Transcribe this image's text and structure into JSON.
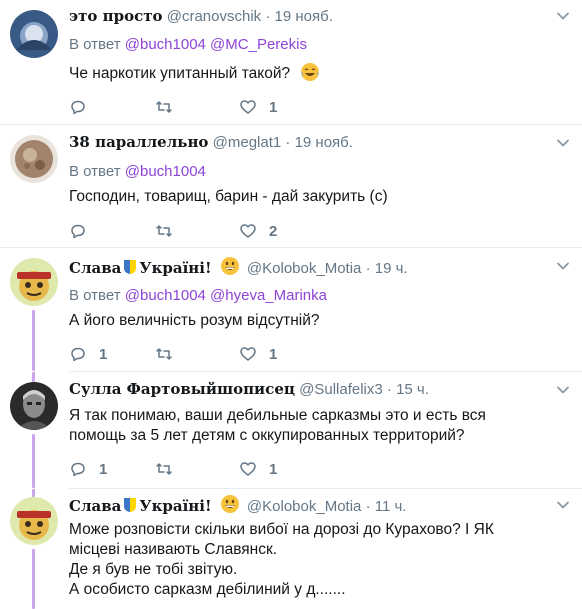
{
  "reply_prefix": "В ответ",
  "tweets": [
    {
      "name": "это просто",
      "handle": "@cranovschik",
      "dot": "·",
      "time": "19 нояб.",
      "mentions": [
        "@buch1004",
        "@MC_Perekis"
      ],
      "lines": [
        "Че наркотик упитанный такой?"
      ],
      "trailing_emoji": "face-with-tears-of-joy",
      "counts": {
        "reply": "",
        "retweet": "",
        "like": "1"
      }
    },
    {
      "name": "38 параллельно",
      "handle": "@meglat1",
      "dot": "·",
      "time": "19 нояб.",
      "mentions": [
        "@buch1004"
      ],
      "lines": [
        "Господин, товарищ, барин - дай закурить (с)"
      ],
      "counts": {
        "reply": "",
        "retweet": "",
        "like": "2"
      }
    },
    {
      "name_part1": "Слава",
      "name_part2": "Україні!",
      "handle": "@Kolobok_Motia",
      "dot": "·",
      "time": "19 ч.",
      "mentions": [
        "@buch1004",
        "@hyeva_Marinka"
      ],
      "lines": [
        "А його величність розум відсутній?"
      ],
      "counts": {
        "reply": "1",
        "retweet": "",
        "like": "1"
      }
    },
    {
      "name": "Сулла Фартовыйшописец",
      "handle": "@Sullafelix3",
      "dot": "·",
      "time": "15 ч.",
      "lines": [
        "Я так понимаю, ваши дебильные сарказмы это и есть вся",
        "помощь за 5 лет детям с оккупированных территорий?"
      ],
      "counts": {
        "reply": "1",
        "retweet": "",
        "like": "1"
      }
    },
    {
      "name_part1": "Слава",
      "name_part2": "Україні!",
      "handle": "@Kolobok_Motia",
      "dot": "·",
      "time": "11 ч.",
      "lines": [
        "Може розповісти скільки вибої на дорозі до Курахово? І ЯК",
        "місцеві називають Славянск.",
        "Де я був не тобі звітую.",
        "А особисто сарказм дебілиний у д......."
      ]
    }
  ],
  "colors": {
    "link": "#8e44d6",
    "secondary": "#657786",
    "thread": "#c9a7ea"
  }
}
